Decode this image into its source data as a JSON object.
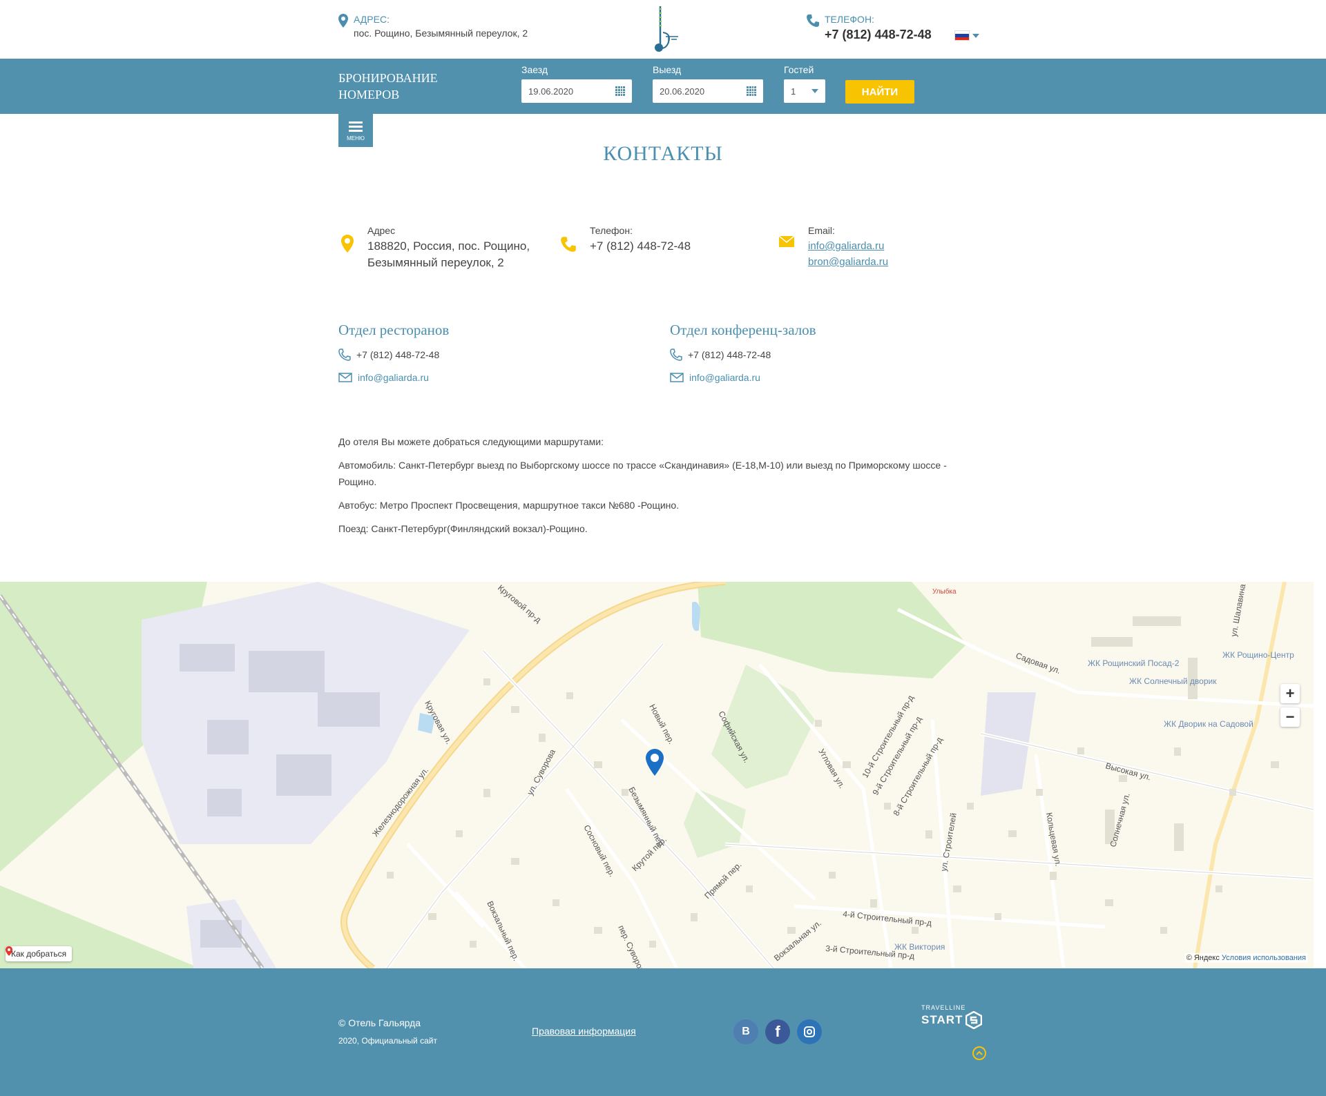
{
  "header": {
    "address_label": "Адрес:",
    "address_value": "пос. Рощино, Безымянный переулок, 2",
    "phone_label": "Телефон:",
    "phone_value": "+7 (812) 448-72-48"
  },
  "booking": {
    "title": "Бронирование номеров",
    "checkin_label": "Заезд",
    "checkin_value": "19.06.2020",
    "checkout_label": "Выезд",
    "checkout_value": "20.06.2020",
    "guests_label": "Гостей",
    "guests_value": "1",
    "find_label": "Найти"
  },
  "menu_label": "Меню",
  "page_title": "Контакты",
  "contacts": {
    "address_label": "Адрес",
    "address_line1": "188820, Россия, пос. Рощино,",
    "address_line2": "Безымянный переулок, 2",
    "phone_label": "Телефон:",
    "phone_value": "+7 (812) 448-72-48",
    "email_label": "Email:",
    "email1": "info@galiarda.ru",
    "email2": "bron@galiarda.ru"
  },
  "departments": [
    {
      "title": "Отдел ресторанов",
      "phone": "+7 (812) 448-72-48",
      "email": "info@galiarda.ru"
    },
    {
      "title": "Отдел конференц-залов",
      "phone": "+7 (812) 448-72-48",
      "email": "info@galiarda.ru"
    }
  ],
  "routes": {
    "intro": "До отеля Вы можете добраться следующими маршрутами:",
    "car": "Автомобиль: Санкт-Петербург выезд по Выборгскому шоссе по трассе «Скандинавия» (Е-18,М-10) или выезд по Приморскому шоссе - Рощино.",
    "bus": "Автобус: Метро Проспект Просвещения, маршрутное такси №680 -Рощино.",
    "train": "Поезд: Санкт-Петербург(Финляндский вокзал)-Рощино."
  },
  "map": {
    "route_button": "Как добраться",
    "copyright": "© Яндекс",
    "terms": "Условия использования",
    "streets": [
      "Железнодорожная ул.",
      "Безымянный пер.",
      "Софийская ул.",
      "Новый пер.",
      "ул. Суворова",
      "Сосновый пер.",
      "Крутой пер.",
      "Прямой пер.",
      "Садовая ул.",
      "Высокая ул.",
      "Кольцевая ул.",
      "Круговая ул.",
      "Вокзальная ул.",
      "Угловая ул.",
      "4-й Строительный пр-д",
      "3-й Строительный пр-д",
      "ул. Строителей",
      "Вокзальный пер.",
      "пер. Суворова",
      "Круговой пр-д",
      "10-й Строительный пр-д",
      "9-й Строительный пр-д",
      "8-й Строительный пр-д",
      "Солнечная ул.",
      "ул. Шалавина"
    ],
    "places": [
      "ЖК Рощинский Посад-2",
      "ЖК Солнечный дворик",
      "ЖК Дворик на Садовой",
      "ЖК Рощино-Центр",
      "ЖК Виктория",
      "Улыбка"
    ],
    "zoom_in": "+",
    "zoom_out": "−"
  },
  "footer": {
    "copyright_prefix": "©",
    "copyright_link": "Отель Гальярда",
    "year_text": "2020, Официальный сайт",
    "legal_link": "Правовая информация",
    "social_vk": "В",
    "social_fb": "f",
    "tl_small": "TRAVELLINE",
    "tl_big": "START"
  },
  "colors": {
    "primary": "#5191ae",
    "accent": "#f8c300",
    "link": "#4a8fb0"
  }
}
